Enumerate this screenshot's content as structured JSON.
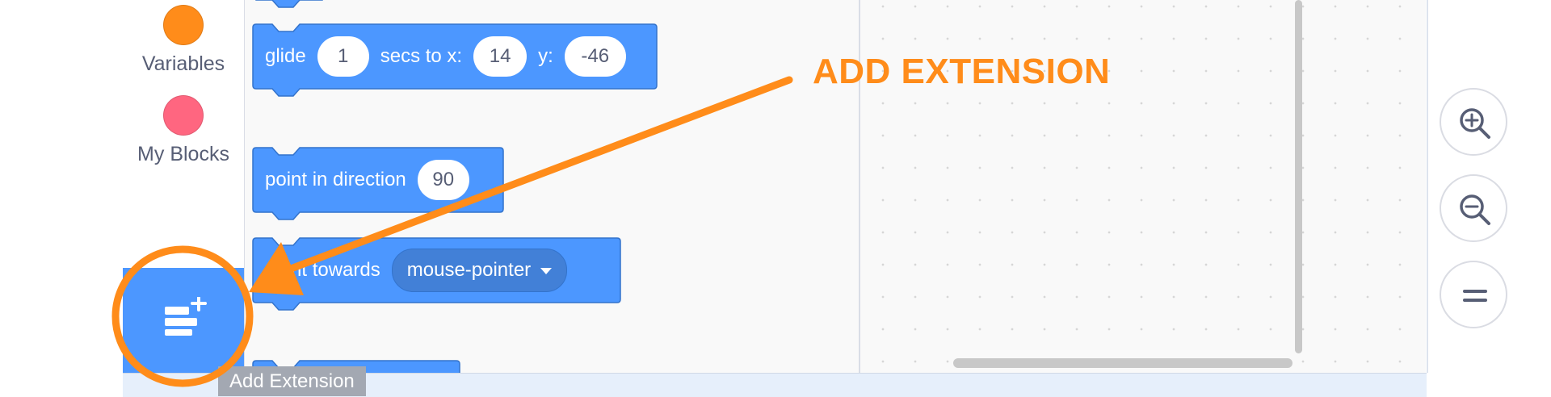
{
  "categories": [
    {
      "label": "Variables",
      "color": "#ff8c1a"
    },
    {
      "label": "My Blocks",
      "color": "#ff6680"
    }
  ],
  "extension_button": {
    "icon": "add-extension-icon",
    "tooltip": "Add Extension"
  },
  "blocks": {
    "glide": {
      "text1": "glide",
      "secs": "1",
      "text2": "secs to x:",
      "x": "14",
      "text3": "y:",
      "y": "-46"
    },
    "point_direction": {
      "text": "point in direction",
      "value": "90"
    },
    "point_towards": {
      "text": "point towards",
      "menu": "mouse-pointer"
    }
  },
  "zoom_controls": [
    {
      "icon": "zoom-in-icon"
    },
    {
      "icon": "zoom-out-icon"
    },
    {
      "icon": "zoom-reset-icon"
    }
  ],
  "annotation": {
    "text": "ADD EXTENSION",
    "color": "#ff8c1a"
  },
  "colors": {
    "motion": "#4c97ff",
    "motion_dark": "#3373cc",
    "accent": "#ff8c1a"
  }
}
